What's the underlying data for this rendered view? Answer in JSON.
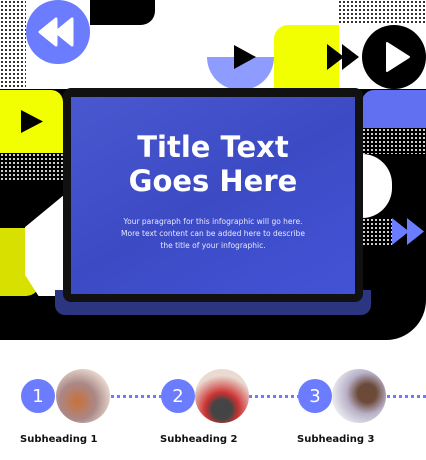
{
  "colors": {
    "accent": "#6b7cff",
    "yellow": "#f2ff00",
    "screen": "#4353d6",
    "black": "#000000"
  },
  "hero": {
    "title_line1": "Title Text",
    "title_line2": "Goes Here",
    "paragraph_line1": "Your paragraph for this infographic will go here.",
    "paragraph_line2": "More text content can be added here to describe",
    "paragraph_line3": "the title of your infographic."
  },
  "icons": [
    "rewind-icon",
    "play-icon",
    "fast-forward-icon",
    "play-circle-icon"
  ],
  "steps": [
    {
      "number": "1",
      "subheading": "Subheading 1"
    },
    {
      "number": "2",
      "subheading": "Subheading 2"
    },
    {
      "number": "3",
      "subheading": "Subheading 3"
    }
  ]
}
